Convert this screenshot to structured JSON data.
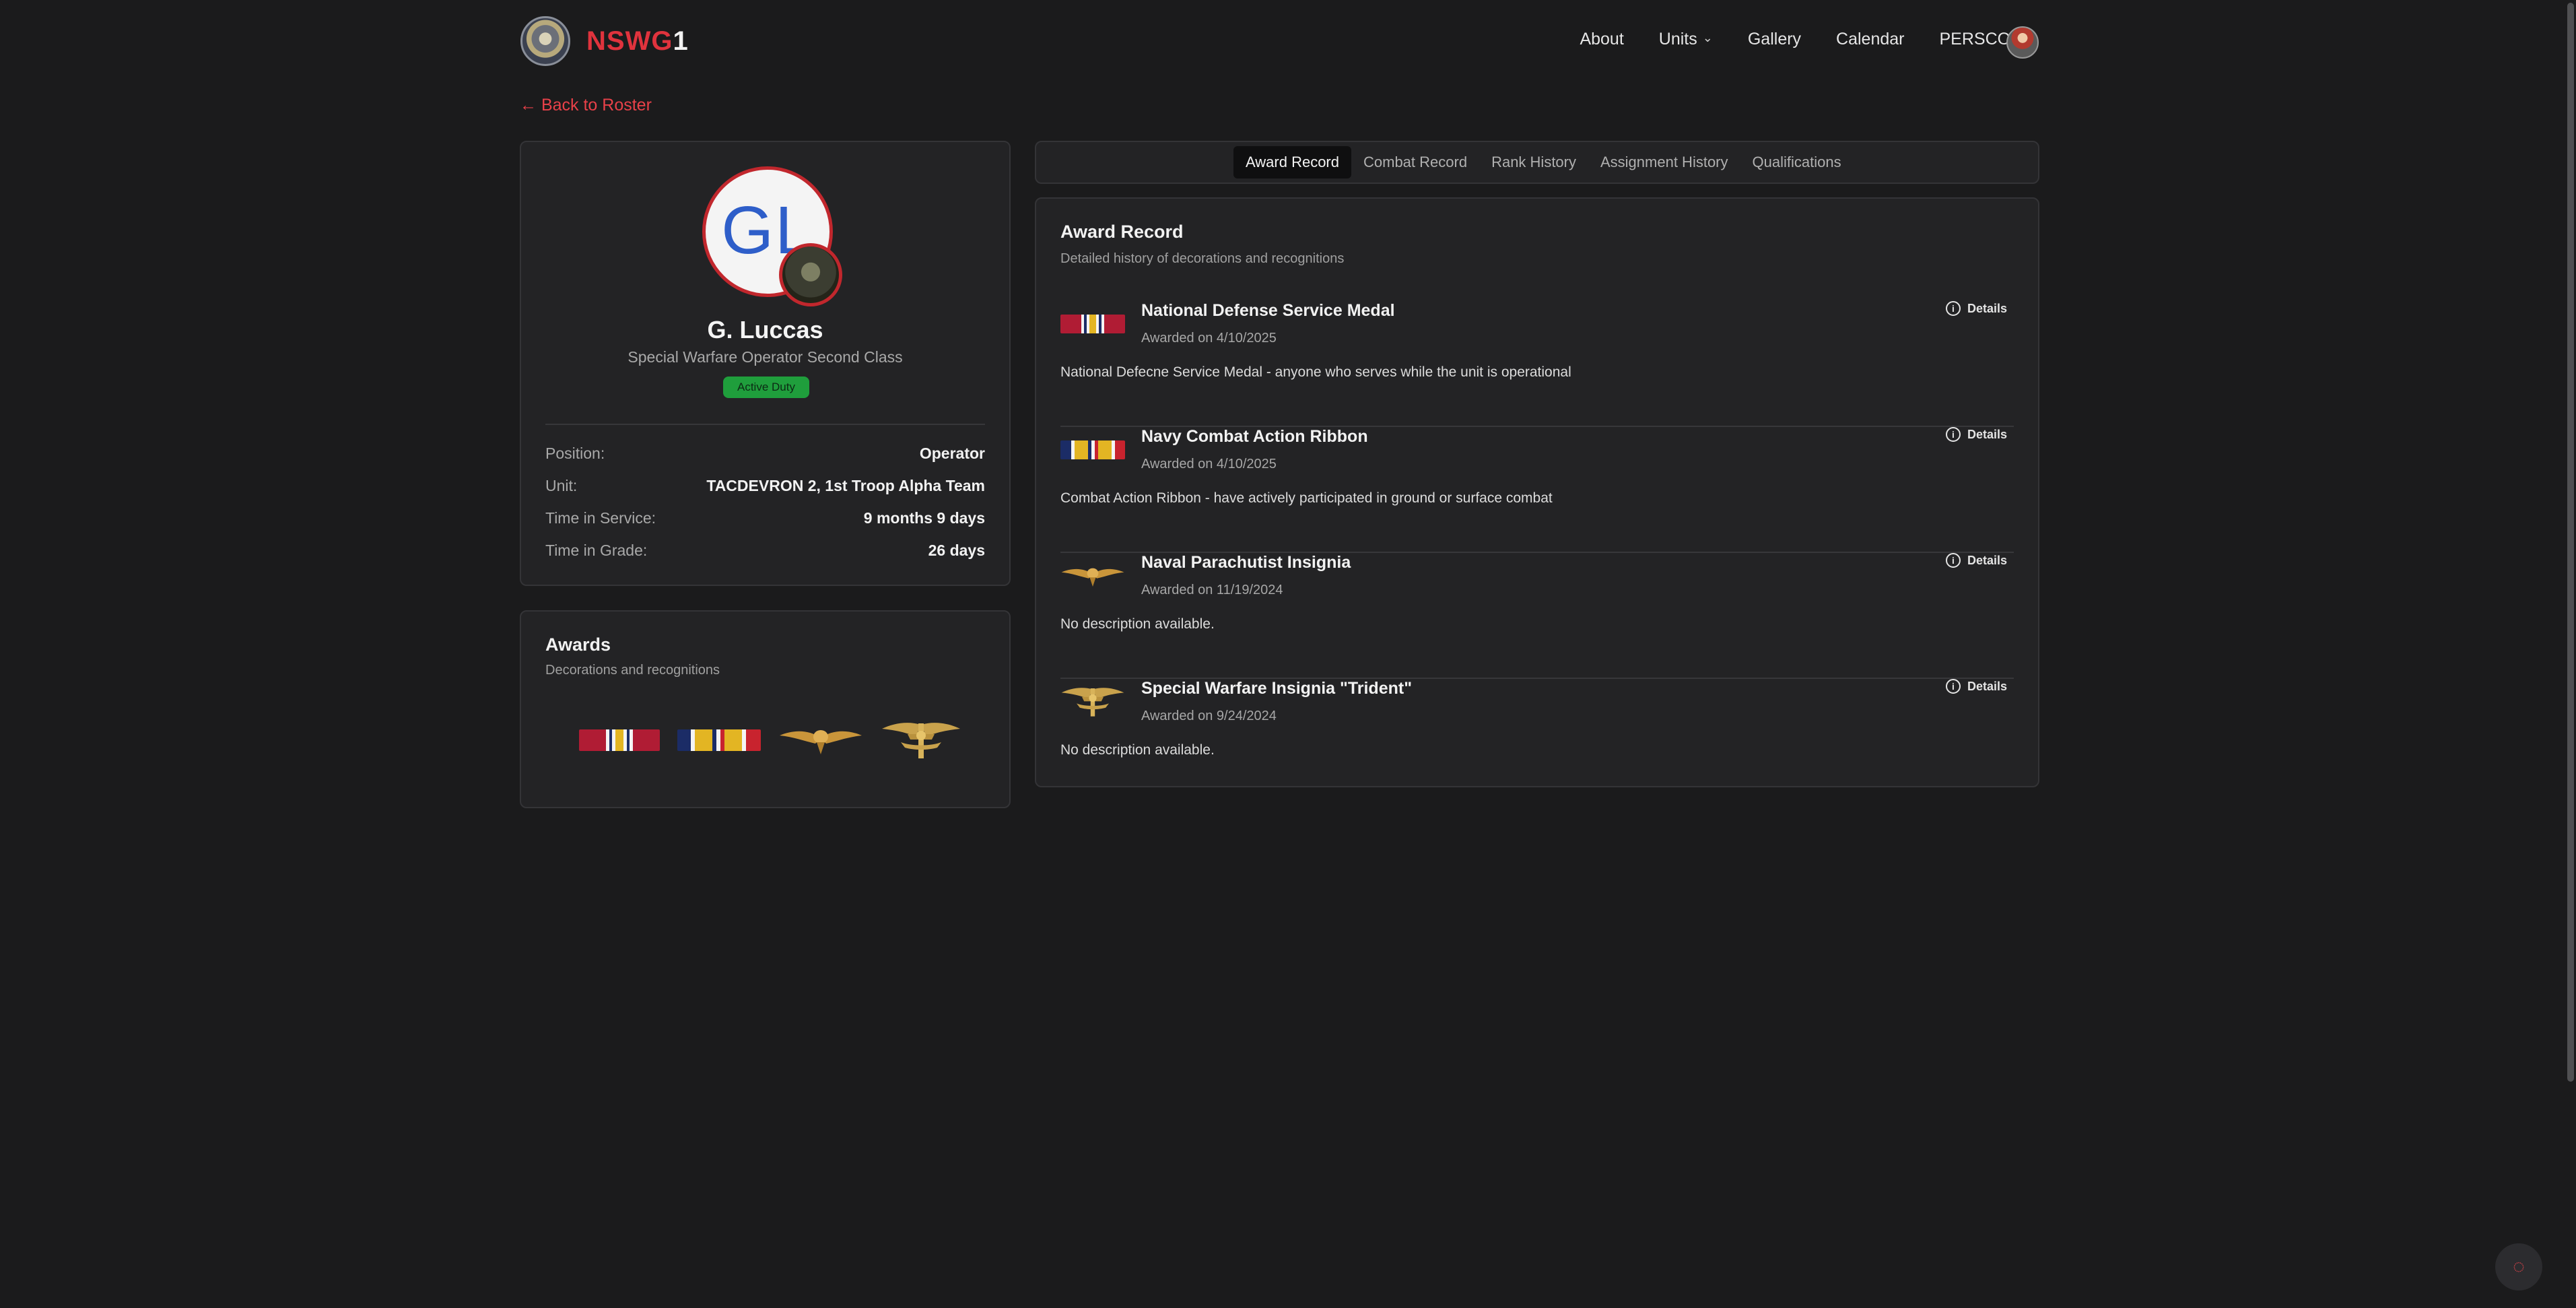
{
  "header": {
    "logo_red": "NSWG",
    "logo_white": "1",
    "nav": [
      {
        "label": "About"
      },
      {
        "label": "Units",
        "dropdown": true
      },
      {
        "label": "Gallery"
      },
      {
        "label": "Calendar"
      },
      {
        "label": "PERSCOM",
        "dropdown": true
      }
    ]
  },
  "back_link": "← Back to Roster",
  "profile": {
    "initials": "GL",
    "name": "G. Luccas",
    "rank": "Special Warfare Operator Second Class",
    "status": "Active Duty",
    "info": [
      {
        "label": "Position:",
        "value": "Operator"
      },
      {
        "label": "Unit:",
        "value": "TACDEVRON 2, 1st Troop Alpha Team"
      },
      {
        "label": "Time in Service:",
        "value": "9 months 9 days"
      },
      {
        "label": "Time in Grade:",
        "value": "26 days"
      }
    ]
  },
  "awards_card": {
    "title": "Awards",
    "subtitle": "Decorations and recognitions"
  },
  "tabs": [
    {
      "label": "Award Record",
      "active": true
    },
    {
      "label": "Combat Record"
    },
    {
      "label": "Rank History"
    },
    {
      "label": "Assignment History"
    },
    {
      "label": "Qualifications"
    }
  ],
  "record": {
    "title": "Award Record",
    "subtitle": "Detailed history of decorations and recognitions",
    "details_label": "Details",
    "items": [
      {
        "name": "National Defense Service Medal",
        "date": "Awarded on 4/10/2025",
        "description": "National Defecne Service Medal - anyone who serves while the unit is operational",
        "icon": "ndsm-ribbon"
      },
      {
        "name": "Navy Combat Action Ribbon",
        "date": "Awarded on 4/10/2025",
        "description": "Combat Action Ribbon  - have actively participated in ground or surface combat",
        "icon": "car-ribbon"
      },
      {
        "name": "Naval Parachutist Insignia",
        "date": "Awarded on 11/19/2024",
        "description": "No description available.",
        "icon": "parachutist-wings"
      },
      {
        "name": "Special Warfare Insignia \"Trident\"",
        "date": "Awarded on 9/24/2024",
        "description": "No description available.",
        "icon": "trident-insignia"
      }
    ]
  },
  "colors": {
    "accent": "#e0333d",
    "background": "#1b1b1c",
    "card": "#232325",
    "status_green": "#1f9e3c"
  }
}
